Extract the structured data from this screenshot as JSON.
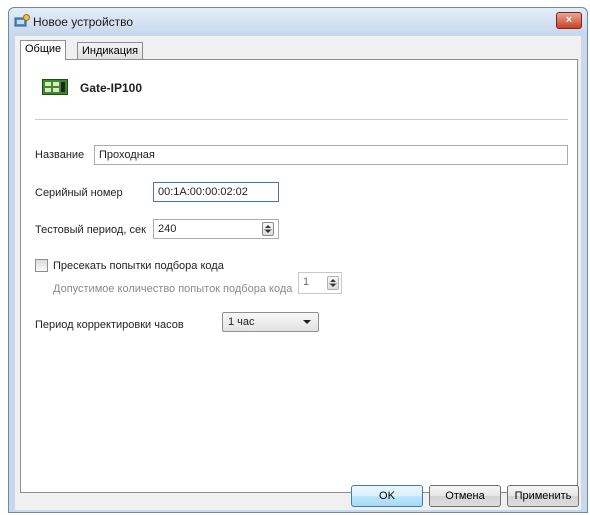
{
  "window": {
    "title": "Новое устройство",
    "icon": "device-settings-icon",
    "close_label": "×"
  },
  "tabs": [
    {
      "label": "Общие",
      "active": true
    },
    {
      "label": "Индикация",
      "active": false
    }
  ],
  "device": {
    "icon": "controller-board-icon",
    "name": "Gate-IP100"
  },
  "form": {
    "name_label": "Название",
    "name_value": "Проходная",
    "serial_label": "Серийный номер",
    "serial_value": "00:1A:00:00:02:02",
    "test_period_label": "Тестовый период, сек",
    "test_period_value": "240",
    "block_bruteforce_label": "Пресекать попытки подбора кода",
    "block_bruteforce_checked": false,
    "allowed_attempts_label": "Допустимое количество попыток подбора кода",
    "allowed_attempts_value": "1",
    "clock_period_label": "Период корректировки часов",
    "clock_period_value": "1 час"
  },
  "buttons": {
    "ok": "OK",
    "cancel": "Отмена",
    "apply": "Применить"
  },
  "colors": {
    "window_frame": "#c9d9ec",
    "close_button": "#c7432b",
    "default_button": "#3c7fb1"
  }
}
